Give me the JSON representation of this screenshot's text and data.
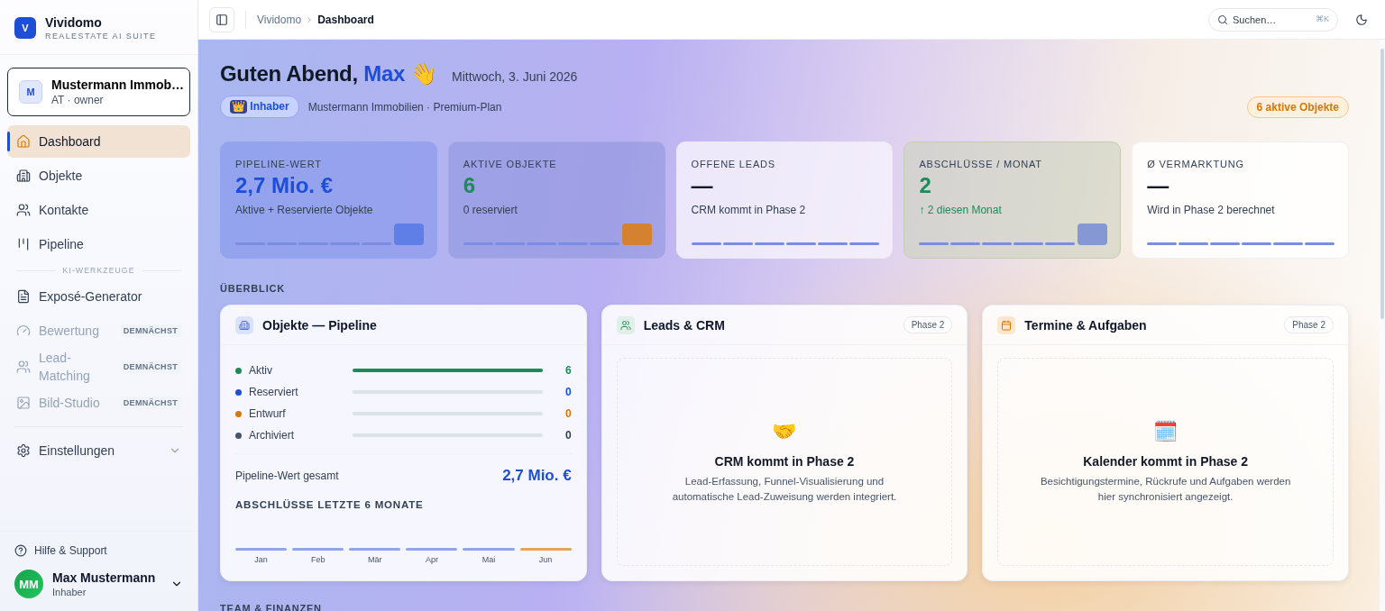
{
  "brand": {
    "logo": "V",
    "name": "Vividomo",
    "tagline": "REALESTATE AI SUITE"
  },
  "account": {
    "initial": "M",
    "name": "Mustermann Immob…",
    "meta": "AT · owner"
  },
  "nav": [
    {
      "label": "Dashboard",
      "selected": true,
      "disabled": false
    },
    {
      "label": "Objekte",
      "selected": false,
      "disabled": false
    },
    {
      "label": "Kontakte",
      "selected": false,
      "disabled": false
    },
    {
      "label": "Pipeline",
      "selected": false,
      "disabled": false
    }
  ],
  "tools_label": "KI-WERKZEUGE",
  "tools": [
    {
      "label": "Exposé-Generator",
      "selected": false,
      "disabled": false
    },
    {
      "label": "Bewertung",
      "selected": false,
      "disabled": true,
      "badge": "DEMNÄCHST"
    },
    {
      "label": "Lead-Matching",
      "selected": false,
      "disabled": true,
      "badge": "DEMNÄCHST"
    },
    {
      "label": "Bild-Studio",
      "selected": false,
      "disabled": true,
      "badge": "DEMNÄCHST"
    }
  ],
  "settings": {
    "label": "Einstellungen",
    "expanded": false
  },
  "help": "Hilfe & Support",
  "user": {
    "initials": "MM",
    "name": "Max Mustermann",
    "role": "Inhaber"
  },
  "breadcrumb": [
    "Vividomo",
    "Dashboard"
  ],
  "search": {
    "placeholder": "Suchen…",
    "shortcut": "⌘K"
  },
  "greeting": {
    "text": "Guten Abend,",
    "name": "Max",
    "emoji": "👋",
    "date": "Mittwoch, 3. Juni 2026"
  },
  "role_badge": {
    "emoji": "👑",
    "label": "Inhaber"
  },
  "org_line": "Mustermann Immobilien · Premium-Plan",
  "active_badge": "6 aktive Objekte",
  "kpis": [
    {
      "kind": "blue",
      "label": "PIPELINE-WERT",
      "value": "2,7 Mio. €",
      "sub": "Aktive + Reservierte Objekte"
    },
    {
      "kind": "green",
      "label": "AKTIVE OBJEKTE",
      "value": "6",
      "sub": "0 reserviert"
    },
    {
      "kind": "plain",
      "label": "OFFENE LEADS",
      "value": "—",
      "sub": "CRM kommt in Phase 2"
    },
    {
      "kind": "olive",
      "label": "ABSCHLÜSSE / MONAT",
      "value": "2",
      "sub": "↑ 2 diesen Monat"
    },
    {
      "kind": "white",
      "label": "Ø VERMARKTUNG",
      "value": "—",
      "sub": "Wird in Phase 2 berechnet"
    }
  ],
  "overview_label": "ÜBERBLICK",
  "pipeline": {
    "title": "Objekte — Pipeline",
    "rows": [
      {
        "label": "Aktiv",
        "color": "#1e8a5a",
        "level": 1,
        "count": "6"
      },
      {
        "label": "Reserviert",
        "color": "#1d4ed8",
        "level": 0,
        "count": "0"
      },
      {
        "label": "Entwurf",
        "color": "#d97706",
        "level": 0,
        "count": "0"
      },
      {
        "label": "Archiviert",
        "color": "#475569",
        "level": 0,
        "count": "0"
      }
    ],
    "total_label": "Pipeline-Wert gesamt",
    "total": "2,7 Mio. €",
    "chart_title": "ABSCHLÜSSE LETZTE 6 MONATE",
    "months": [
      {
        "label": "Jan",
        "selected": false
      },
      {
        "label": "Feb",
        "selected": false
      },
      {
        "label": "Mär",
        "selected": false
      },
      {
        "label": "Apr",
        "selected": false
      },
      {
        "label": "Mai",
        "selected": false
      },
      {
        "label": "Jun",
        "selected": true
      }
    ]
  },
  "phase_cards": [
    {
      "title": "Leads & CRM",
      "badge": "Phase 2",
      "emoji": "🤝",
      "heading": "CRM kommt in Phase 2",
      "text": "Lead-Erfassung, Funnel-Visualisierung und automatische Lead-Zuweisung werden integriert."
    },
    {
      "title": "Termine & Aufgaben",
      "badge": "Phase 2",
      "emoji": "🗓️",
      "heading": "Kalender kommt in Phase 2",
      "text": "Besichtigungstermine, Rückrufe und Aufgaben werden hier synchronisiert angezeigt."
    }
  ],
  "team_label": "TEAM & FINANZEN"
}
